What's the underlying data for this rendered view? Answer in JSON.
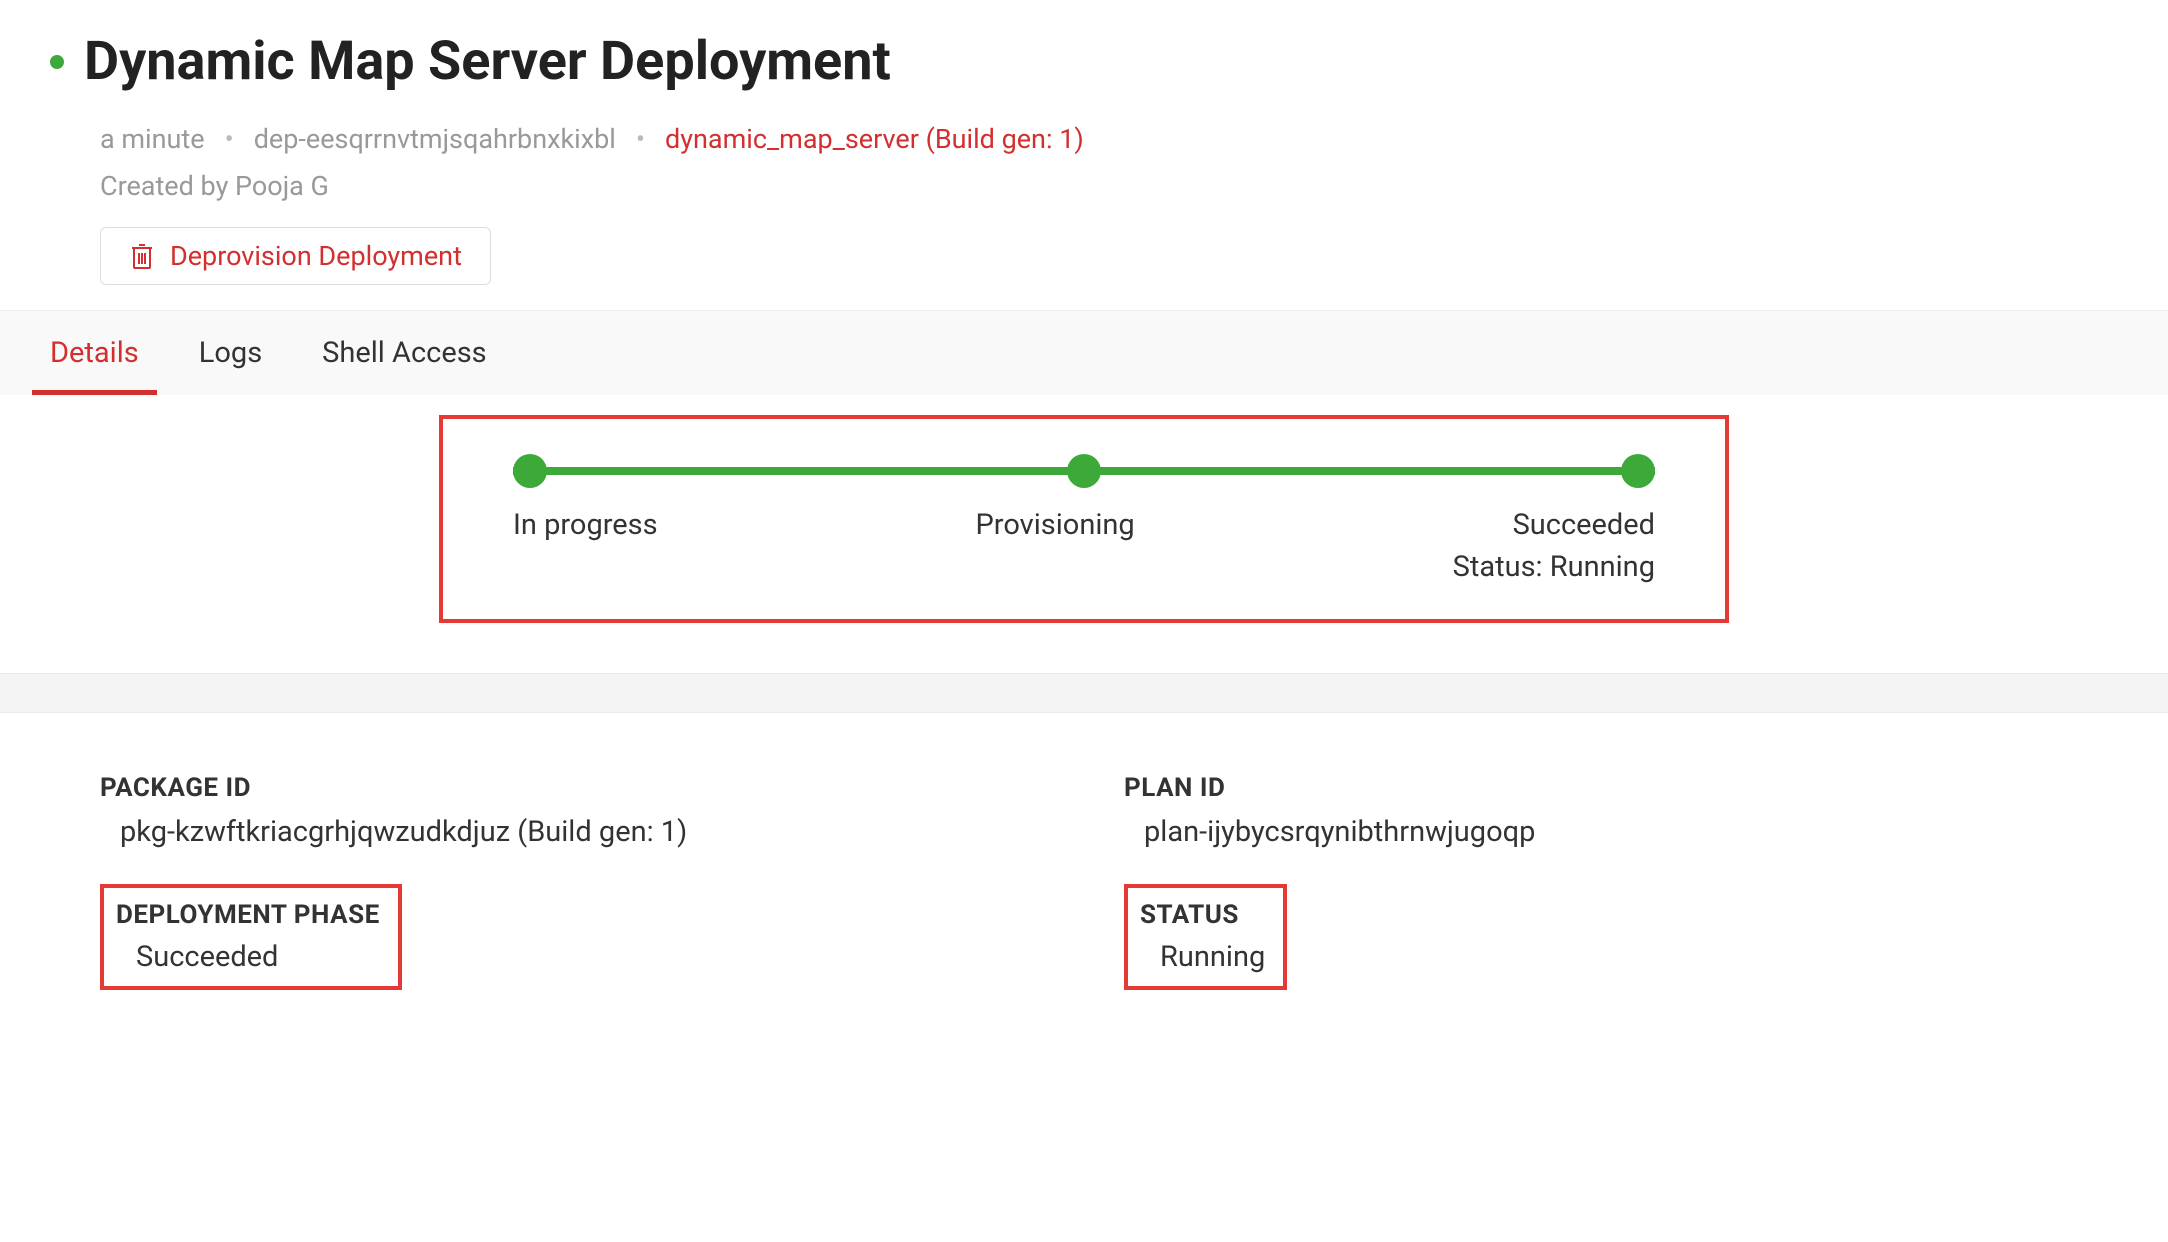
{
  "header": {
    "title": "Dynamic Map Server Deployment",
    "time": "a minute",
    "deployment_id": "dep-eesqrrnvtmjsqahrbnxkixbl",
    "build_link": "dynamic_map_server (Build gen: 1)",
    "created_by": "Created by Pooja G"
  },
  "actions": {
    "deprovision_label": "Deprovision Deployment"
  },
  "tabs": [
    {
      "label": "Details",
      "active": true
    },
    {
      "label": "Logs",
      "active": false
    },
    {
      "label": "Shell Access",
      "active": false
    }
  ],
  "progress": {
    "steps": [
      {
        "label": "In progress"
      },
      {
        "label": "Provisioning"
      },
      {
        "label": "Succeeded"
      }
    ],
    "status_label": "Status: Running"
  },
  "details": {
    "package_id_label": "PACKAGE ID",
    "package_id_value": "pkg-kzwftkriacgrhjqwzudkdjuz (Build gen: 1)",
    "plan_id_label": "PLAN ID",
    "plan_id_value": "plan-ijybycsrqynibthrnwjugoqp",
    "deployment_phase_label": "DEPLOYMENT PHASE",
    "deployment_phase_value": "Succeeded",
    "status_label": "STATUS",
    "status_value": "Running"
  }
}
